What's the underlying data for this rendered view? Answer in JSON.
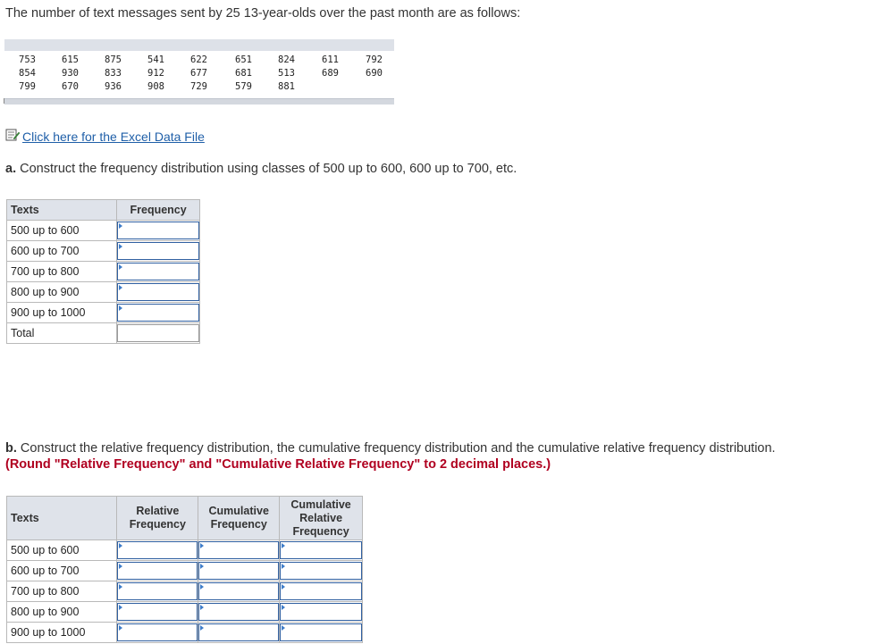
{
  "intro": "The number of text messages sent by 25 13-year-olds over the past month are as follows:",
  "data_values": [
    [
      "753",
      "615",
      "875",
      "541",
      "622",
      "651",
      "824",
      "611",
      "792"
    ],
    [
      "854",
      "930",
      "833",
      "912",
      "677",
      "681",
      "513",
      "689",
      "690"
    ],
    [
      "799",
      "670",
      "936",
      "908",
      "729",
      "579",
      "881"
    ]
  ],
  "excel_link": "Click here for the Excel Data File",
  "part_a": {
    "prefix": "a.",
    "text": "Construct the frequency distribution using classes of 500 up to 600, 600 up to 700, etc.",
    "table": {
      "col_texts": "Texts",
      "col_freq": "Frequency",
      "rows": [
        "500 up to 600",
        "600 up to 700",
        "700 up to 800",
        "800 up to 900",
        "900 up to 1000"
      ],
      "total": "Total"
    }
  },
  "part_b": {
    "prefix": "b.",
    "text": "Construct the relative frequency distribution, the cumulative frequency distribution and the cumulative relative frequency distribution.",
    "note": "(Round \"Relative Frequency\" and \"Cumulative Relative Frequency\" to 2 decimal places.)",
    "table": {
      "col_texts": "Texts",
      "col_rel": "Relative Frequency",
      "col_cum": "Cumulative Frequency",
      "col_cumrel": "Cumulative Relative Frequency",
      "rows": [
        "500 up to 600",
        "600 up to 700",
        "700 up to 800",
        "800 up to 900",
        "900 up to 1000"
      ]
    }
  },
  "colors": {
    "link": "#1f5fa8",
    "note_red": "#b00020",
    "header_bg": "#dfe3ea",
    "input_border": "#2f5fa0"
  },
  "icons": {
    "excel": "document-edit-icon",
    "input_marker": "triangle-right-icon"
  }
}
